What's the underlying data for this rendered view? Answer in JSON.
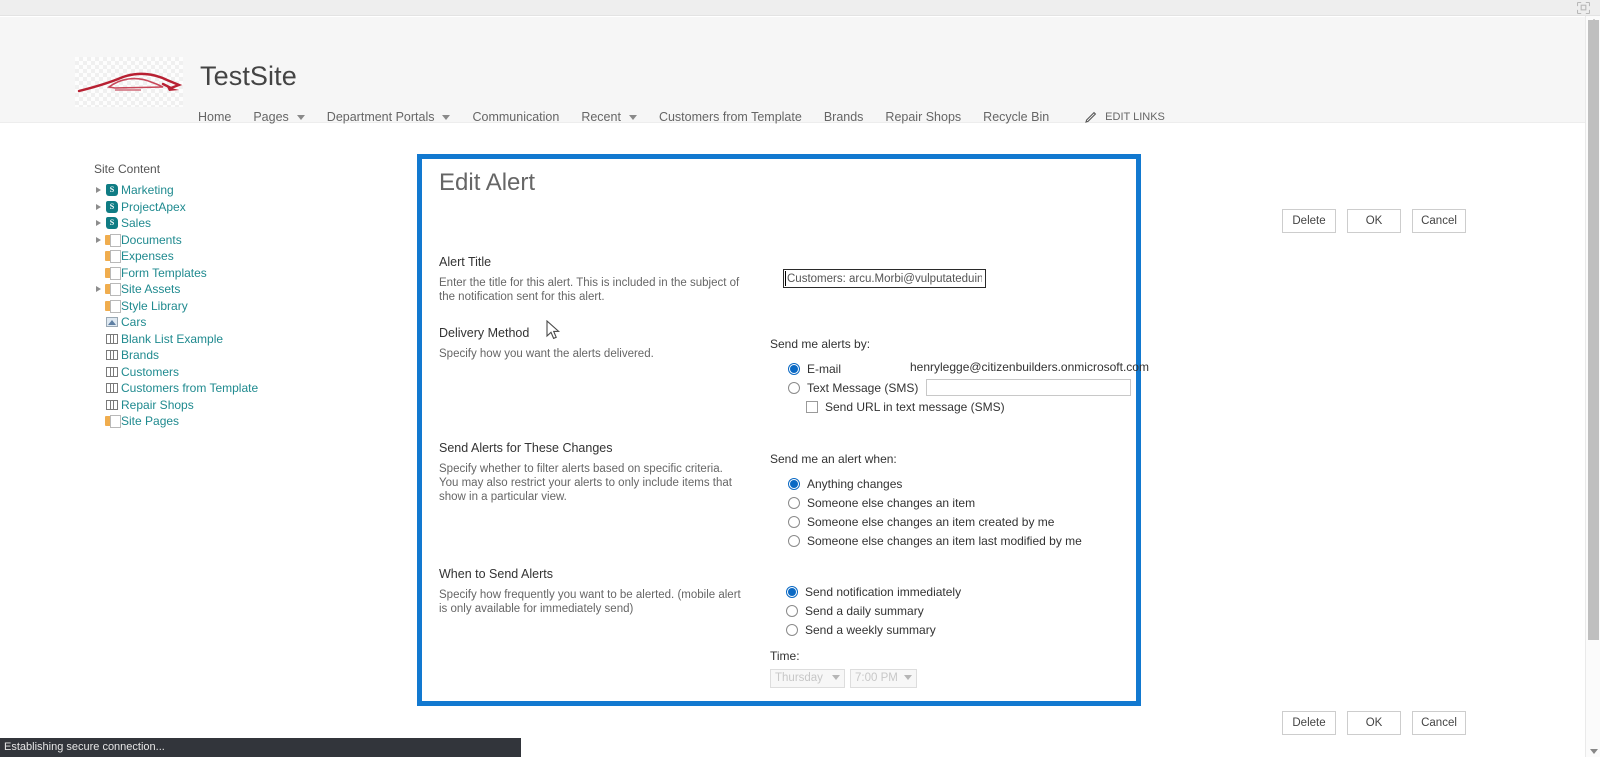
{
  "browser": {
    "chrome_icon": "fullscreen-icon"
  },
  "site": {
    "logo_alt": "car-logo",
    "title": "TestSite",
    "nav": [
      {
        "label": "Home",
        "has_caret": false
      },
      {
        "label": "Pages",
        "has_caret": true
      },
      {
        "label": "Department Portals",
        "has_caret": true
      },
      {
        "label": "Communication",
        "has_caret": false
      },
      {
        "label": "Recent",
        "has_caret": true
      },
      {
        "label": "Customers from Template",
        "has_caret": false
      },
      {
        "label": "Brands",
        "has_caret": false
      },
      {
        "label": "Repair Shops",
        "has_caret": false
      },
      {
        "label": "Recycle Bin",
        "has_caret": false
      }
    ],
    "edit_links": "EDIT LINKS"
  },
  "tree": {
    "header": "Site Content",
    "items": [
      {
        "label": "Marketing",
        "icon": "sharepoint-site-icon",
        "expandable": true,
        "indent": 0
      },
      {
        "label": "ProjectApex",
        "icon": "sharepoint-site-icon",
        "expandable": true,
        "indent": 0
      },
      {
        "label": "Sales",
        "icon": "sharepoint-site-icon",
        "expandable": true,
        "indent": 0
      },
      {
        "label": "Documents",
        "icon": "document-library-icon",
        "expandable": true,
        "indent": 0
      },
      {
        "label": "Expenses",
        "icon": "document-library-icon",
        "expandable": false,
        "indent": 0
      },
      {
        "label": "Form Templates",
        "icon": "document-library-icon",
        "expandable": false,
        "indent": 0
      },
      {
        "label": "Site Assets",
        "icon": "document-library-icon",
        "expandable": true,
        "indent": 0
      },
      {
        "label": "Style Library",
        "icon": "document-library-icon",
        "expandable": false,
        "indent": 0
      },
      {
        "label": "Cars",
        "icon": "picture-library-icon",
        "expandable": false,
        "indent": 0
      },
      {
        "label": "Blank List Example",
        "icon": "list-icon",
        "expandable": false,
        "indent": 0
      },
      {
        "label": "Brands",
        "icon": "list-icon",
        "expandable": false,
        "indent": 0
      },
      {
        "label": "Customers",
        "icon": "list-icon",
        "expandable": false,
        "indent": 0
      },
      {
        "label": "Customers from Template",
        "icon": "list-icon",
        "expandable": false,
        "indent": 0
      },
      {
        "label": "Repair Shops",
        "icon": "list-icon",
        "expandable": false,
        "indent": 0
      },
      {
        "label": "Site Pages",
        "icon": "document-library-icon",
        "expandable": false,
        "indent": 0
      }
    ]
  },
  "dialog": {
    "title": "Edit Alert",
    "accent_color": "#1279d0",
    "alert_title": {
      "heading": "Alert Title",
      "description": "Enter the title for this alert. This is included in the subject of the notification sent for this alert.",
      "value": "Customers: arcu.Morbi@vulputateduinec."
    },
    "delivery_method": {
      "heading": "Delivery Method",
      "description": "Specify how you want the alerts delivered.",
      "right_label": "Send me alerts by:",
      "email_option": "E-mail",
      "email_value": "henrylegge@citizenbuilders.onmicrosoft.com",
      "sms_option": "Text Message (SMS)",
      "sms_value": "",
      "sms_placeholder": "",
      "send_url_option": "Send URL in text message (SMS)",
      "selected": "E-mail",
      "send_url_checked": false
    },
    "send_alerts_changes": {
      "heading": "Send Alerts for These Changes",
      "description": "Specify whether to filter alerts based on specific criteria. You may also restrict your alerts to only include items that show in a particular view.",
      "right_label": "Send me an alert when:",
      "options": [
        "Anything changes",
        "Someone else changes an item",
        "Someone else changes an item created by me",
        "Someone else changes an item last modified by me"
      ],
      "selected": "Anything changes"
    },
    "when_to_send": {
      "heading": "When to Send Alerts",
      "description": "Specify how frequently you want to be alerted. (mobile alert is only available for immediately send)",
      "options": [
        "Send notification immediately",
        "Send a daily summary",
        "Send a weekly summary"
      ],
      "selected": "Send notification immediately",
      "time_label": "Time:",
      "day_value": "Thursday",
      "hour_value": "7:00 PM",
      "time_disabled": true
    }
  },
  "buttons": {
    "delete": "Delete",
    "ok": "OK",
    "cancel": "Cancel"
  },
  "status": {
    "message": "Establishing secure connection..."
  }
}
